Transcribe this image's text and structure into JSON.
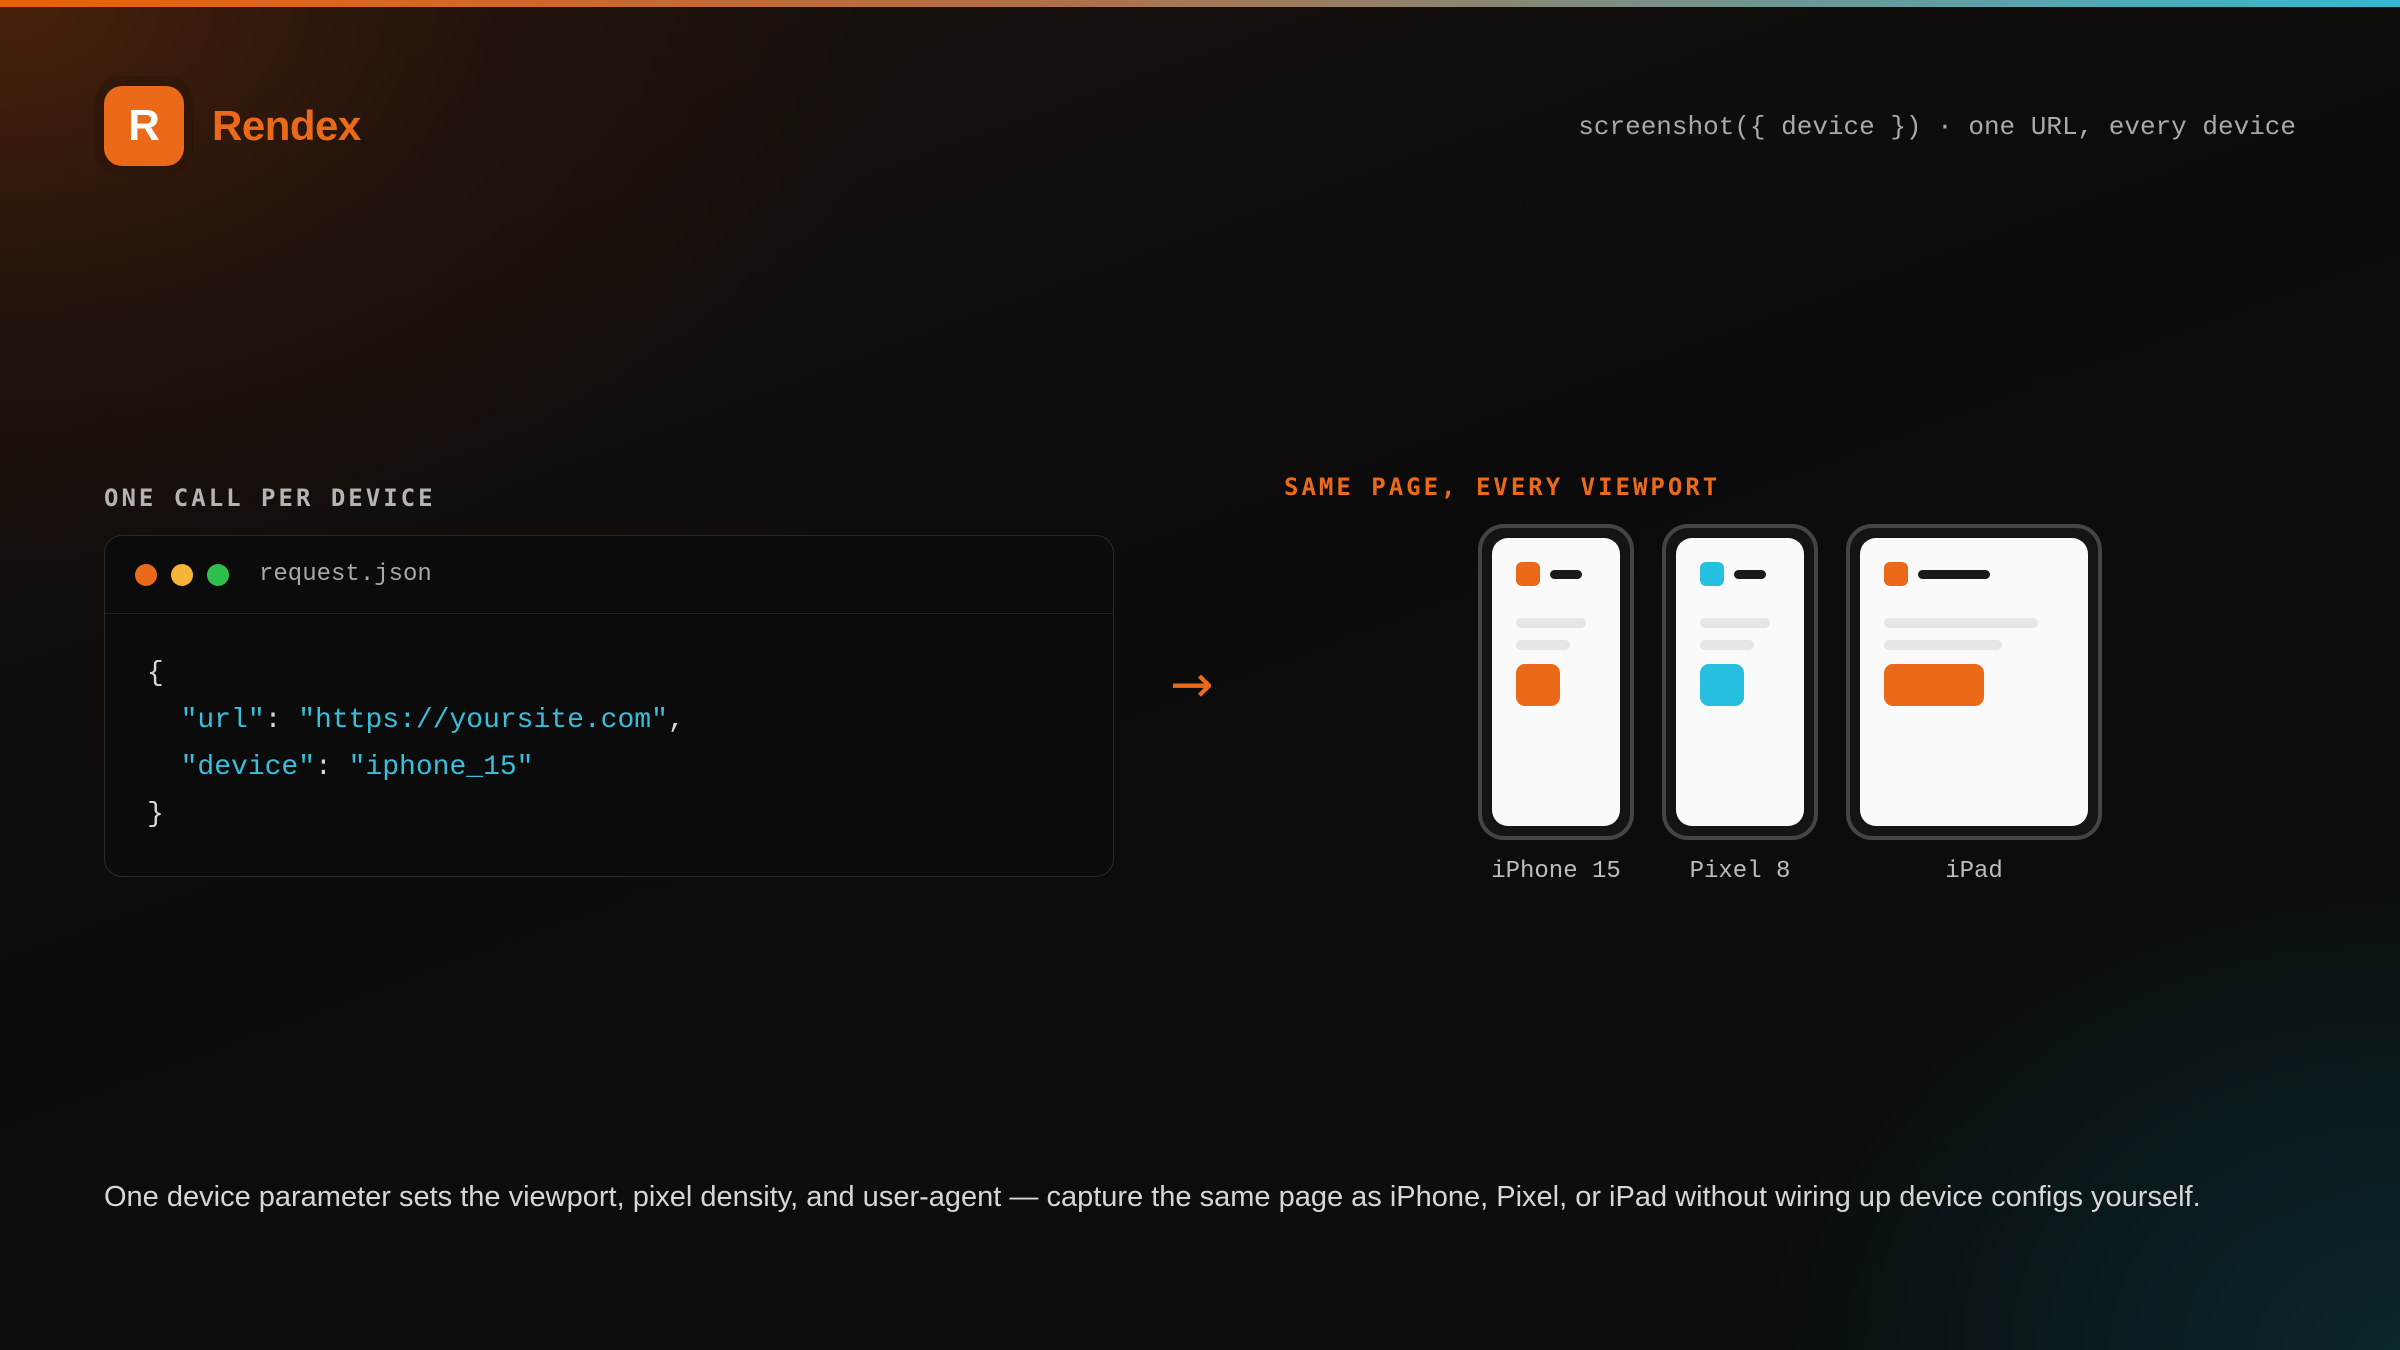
{
  "brand": {
    "logo_letter": "R",
    "name": "Rendex",
    "accent": "#ea6a1a"
  },
  "tagline": "screenshot({ device }) · one URL, every device",
  "left_section": {
    "label": "ONE CALL PER DEVICE",
    "window": {
      "traffic_lights": [
        "#ea6a1a",
        "#f5b43a",
        "#2ec04a"
      ],
      "filename": "request.json",
      "code": {
        "open": "{",
        "url_key": "\"url\"",
        "url_value": "\"https://yoursite.com\"",
        "device_key": "\"device\"",
        "device_value": "\"iphone_15\"",
        "close": "}"
      }
    }
  },
  "arrow": "→",
  "right_section": {
    "label": "SAME PAGE, EVERY VIEWPORT",
    "devices": [
      {
        "name": "iPhone 15",
        "accent": "#ea6a1a"
      },
      {
        "name": "Pixel 8",
        "accent": "#27bfe0"
      },
      {
        "name": "iPad",
        "accent": "#ea6a1a"
      }
    ]
  },
  "description": "One device parameter sets the viewport, pixel density, and user-agent — capture the same page as iPhone, Pixel, or iPad without wiring up device configs yourself."
}
